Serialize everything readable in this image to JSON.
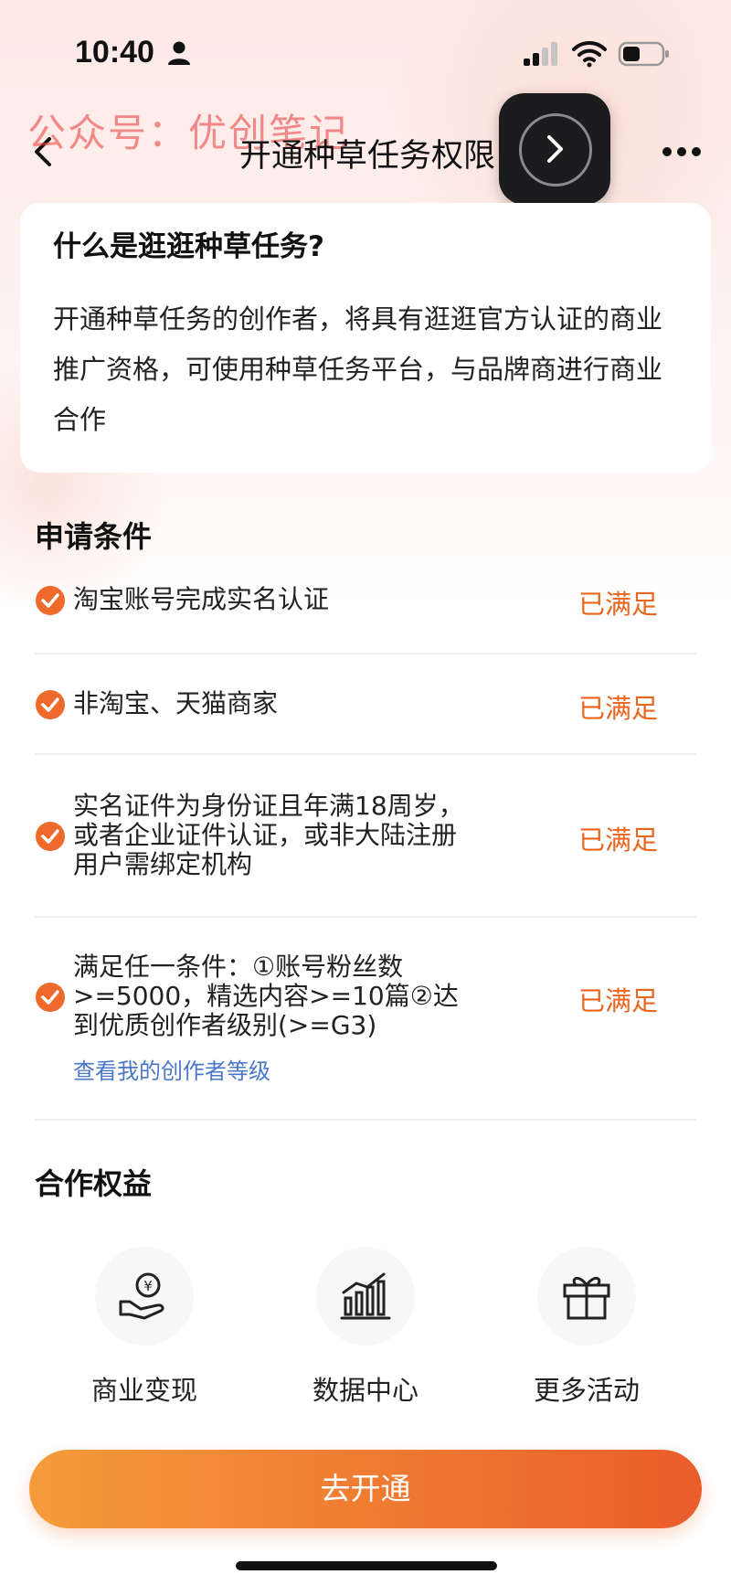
{
  "status_bar": {
    "time": "10:40"
  },
  "nav": {
    "title": "开通种草任务权限",
    "watermark": "公众号：优创笔记"
  },
  "intro": {
    "title": "什么是逛逛种草任务?",
    "body": "开通种草任务的创作者，将具有逛逛官方认证的商业推广资格，可使用种草任务平台，与品牌商进行商业合作"
  },
  "conditions": {
    "title": "申请条件",
    "items": [
      {
        "text": "淘宝账号完成实名认证",
        "status": "已满足"
      },
      {
        "text": "非淘宝、天猫商家",
        "status": "已满足"
      },
      {
        "text": "实名证件为身份证且年满18周岁，或者企业证件认证，或非大陆注册用户需绑定机构",
        "status": "已满足"
      },
      {
        "text": "满足任一条件：①账号粉丝数>=5000，精选内容>=10篇②达到优质创作者级别(>=G3)",
        "status": "已满足",
        "link": "查看我的创作者等级"
      }
    ]
  },
  "benefits": {
    "title": "合作权益",
    "items": [
      {
        "label": "商业变现",
        "icon": "money-hand-icon"
      },
      {
        "label": "数据中心",
        "icon": "bar-chart-icon"
      },
      {
        "label": "更多活动",
        "icon": "gift-icon"
      }
    ]
  },
  "cta": {
    "label": "去开通"
  },
  "colors": {
    "accent": "#e8661f",
    "link": "#4a78c8",
    "cta_start": "#f59b3a",
    "cta_end": "#ea5d2b"
  }
}
